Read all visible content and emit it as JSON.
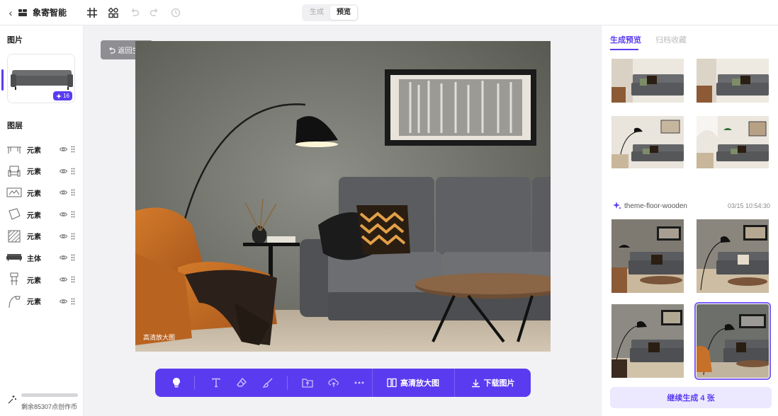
{
  "app": {
    "brand": "象寄智能"
  },
  "mode_toggle": {
    "options": [
      "生成",
      "预览"
    ],
    "active": "预览"
  },
  "left_panel": {
    "image_section_title": "图片",
    "thumb_count": "16",
    "layers_title": "图层",
    "layers": [
      {
        "name": "元素",
        "icon": "table-icon"
      },
      {
        "name": "元素",
        "icon": "armchair-icon"
      },
      {
        "name": "元素",
        "icon": "picture-frame-icon"
      },
      {
        "name": "元素",
        "icon": "cushion-icon"
      },
      {
        "name": "元素",
        "icon": "pillow-icon"
      },
      {
        "name": "主体",
        "icon": "sofa-icon"
      },
      {
        "name": "元素",
        "icon": "side-table-icon"
      },
      {
        "name": "元素",
        "icon": "floor-lamp-icon"
      }
    ],
    "credits_text": "剩余85307点创作币"
  },
  "canvas": {
    "return_label": "返回生成",
    "hd_tag": "高清放大图"
  },
  "toolbar": {
    "hd_label": "高清放大图",
    "download_label": "下载图片"
  },
  "right_panel": {
    "tabs": [
      "生成预览",
      "归档收藏"
    ],
    "active_tab": "生成预览",
    "theme_name": "theme-floor-wooden",
    "theme_time": "03/15 10:54:30",
    "continue_label": "继续生成 4 张"
  },
  "colors": {
    "accent": "#5b3bf0",
    "accent_light": "#ece8fe"
  }
}
